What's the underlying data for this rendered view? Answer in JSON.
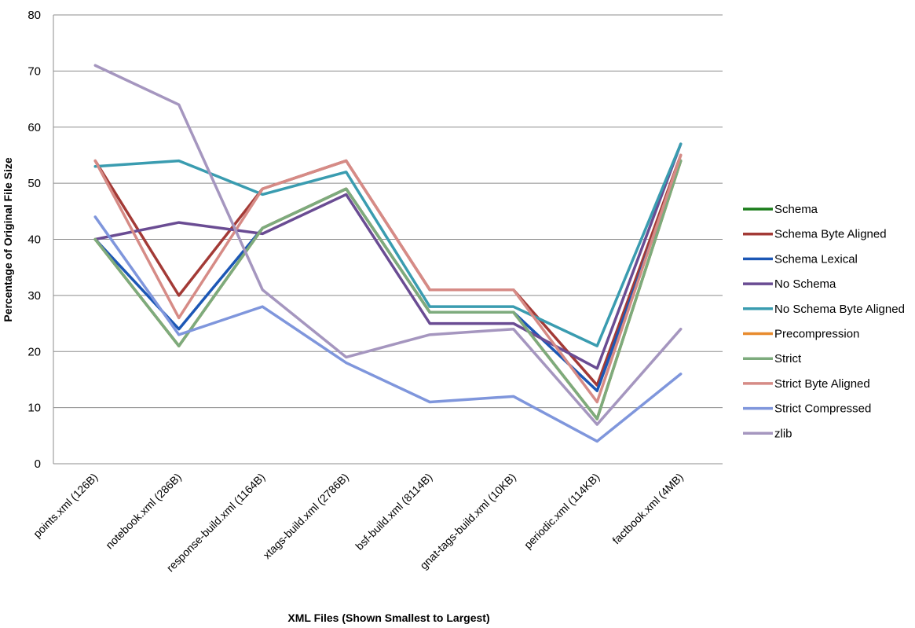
{
  "chart_data": {
    "type": "line",
    "title": "",
    "xlabel": "XML Files (Shown Smallest to Largest)",
    "ylabel": "Percentage of Original File Size",
    "ylim": [
      0,
      80
    ],
    "yticks": [
      0,
      10,
      20,
      30,
      40,
      50,
      60,
      70,
      80
    ],
    "grid": true,
    "legend_position": "right",
    "categories": [
      "points.xml (126B)",
      "notebook.xml (286B)",
      "response-build.xml (1164B)",
      "xtags-build.xml (2786B)",
      "bsf-build.xml (8114B)",
      "gnat-tags-build.xml (10KB)",
      "periodic.xml (114KB)",
      "factbook.xml (4MB)"
    ],
    "series": [
      {
        "name": "Schema",
        "color": "#1a7d1a",
        "values": [
          40,
          21,
          42,
          49,
          27,
          27,
          8,
          54
        ]
      },
      {
        "name": "Schema Byte Aligned",
        "color": "#a33a36",
        "values": [
          54,
          30,
          49,
          54,
          31,
          31,
          14,
          55
        ]
      },
      {
        "name": "Schema Lexical",
        "color": "#1c57b5",
        "values": [
          40,
          24,
          42,
          49,
          27,
          27,
          13,
          54
        ]
      },
      {
        "name": "No Schema",
        "color": "#6a4c93",
        "values": [
          40,
          43,
          41,
          48,
          25,
          25,
          17,
          57
        ]
      },
      {
        "name": "No Schema Byte Aligned",
        "color": "#3a9cb0",
        "values": [
          53,
          54,
          48,
          52,
          28,
          28,
          21,
          57
        ]
      },
      {
        "name": "Precompression",
        "color": "#e88b2e",
        "values": [
          40,
          21,
          42,
          49,
          27,
          27,
          8,
          54
        ]
      },
      {
        "name": "Strict",
        "color": "#7dab7d",
        "values": [
          40,
          21,
          42,
          49,
          27,
          27,
          8,
          54
        ]
      },
      {
        "name": "Strict Byte Aligned",
        "color": "#d68b86",
        "values": [
          54,
          26,
          49,
          54,
          31,
          31,
          11,
          55
        ]
      },
      {
        "name": "Strict Compressed",
        "color": "#7f96dc",
        "values": [
          44,
          23,
          28,
          18,
          11,
          12,
          4,
          16
        ]
      },
      {
        "name": "zlib",
        "color": "#a596bf",
        "values": [
          71,
          64,
          31,
          19,
          23,
          24,
          7,
          24
        ]
      }
    ]
  }
}
